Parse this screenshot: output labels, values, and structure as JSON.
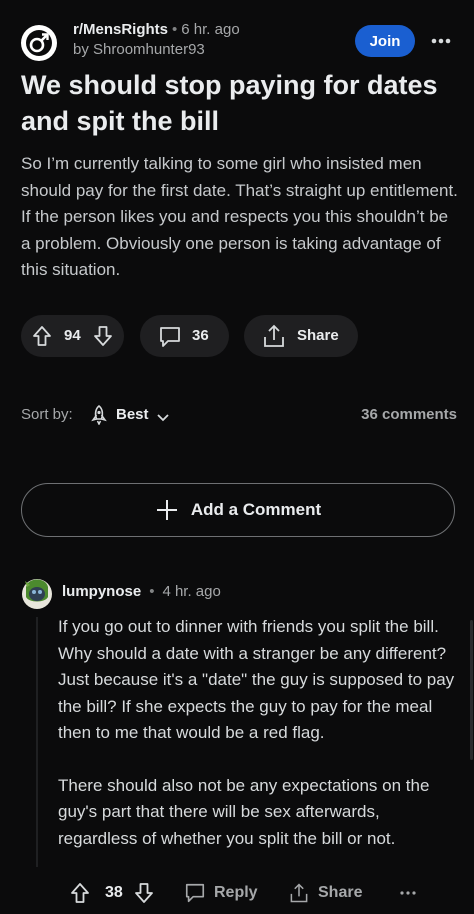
{
  "post": {
    "subreddit": "r/MensRights",
    "age": "6 hr. ago",
    "author_line": "by Shroomhunter93",
    "join_label": "Join",
    "title": "We should stop paying for dates and spit the bill",
    "body": "So I’m currently talking to some girl who insisted men should pay for the first date. That’s straight up entitlement. If the person likes you and respects you this shouldn’t be a problem. Obviously one person is taking advantage of this situation.",
    "votes": "94",
    "comments": "36",
    "share_label": "Share"
  },
  "sort": {
    "label": "Sort by:",
    "value": "Best",
    "count_label": "36 comments"
  },
  "add_comment_label": "Add a Comment",
  "comment": {
    "author": "lumpynose",
    "age": "4 hr. ago",
    "paragraphs": [
      "If you go out to dinner with friends you split the bill. Why should a date with a stranger be any different? Just because it's a \"date\" the guy is supposed to pay the bill? If she expects the guy to pay for the meal then to me that would be a red flag.",
      "There should also not be any expectations on the guy's part that there will be sex afterwards, regardless of whether you split the bill or not."
    ],
    "votes": "38",
    "reply_label": "Reply",
    "share_label": "Share"
  },
  "colors": {
    "background": "#0b0b0c",
    "join_blue": "#1a5fd1",
    "pill": "#1f1f21"
  }
}
